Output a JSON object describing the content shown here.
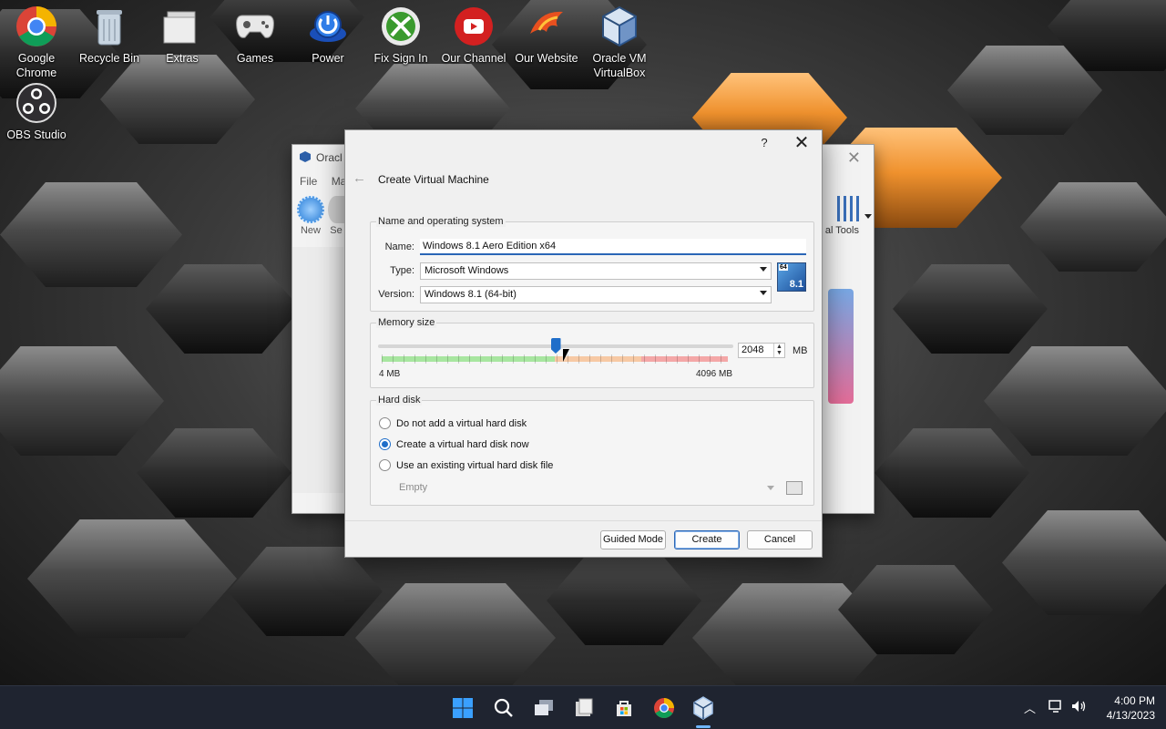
{
  "desktop": {
    "icons": [
      {
        "label": "Google Chrome",
        "icon": "chrome-icon"
      },
      {
        "label": "Recycle Bin",
        "icon": "recycle-bin-icon"
      },
      {
        "label": "Extras",
        "icon": "folder-icon"
      },
      {
        "label": "Games",
        "icon": "gamepad-icon"
      },
      {
        "label": "Power",
        "icon": "power-icon"
      },
      {
        "label": "Fix Sign In",
        "icon": "xbox-icon"
      },
      {
        "label": "Our Channel",
        "icon": "youtube-icon"
      },
      {
        "label": "Our Website",
        "icon": "phoenix-icon"
      },
      {
        "label": "Oracle VM VirtualBox",
        "icon": "virtualbox-icon"
      },
      {
        "label": "OBS Studio",
        "icon": "obs-icon"
      }
    ]
  },
  "bg_window": {
    "title": "Oracl",
    "menu_file": "File",
    "menu_machine": "Ma",
    "toolbar_new": "New",
    "toolbar_settings": "Se",
    "toolbar_tools": "al Tools"
  },
  "dialog": {
    "help": "?",
    "close": "✕",
    "back": "←",
    "title": "Create Virtual Machine",
    "name_os_group": "Name and operating system",
    "name_label": "Name:",
    "name_value": "Windows 8.1 Aero Edition x64",
    "type_label": "Type:",
    "type_value": "Microsoft Windows",
    "version_label": "Version:",
    "version_value": "Windows 8.1 (64-bit)",
    "os_badge_bits": "64",
    "os_badge_version": "8.1",
    "memory_group": "Memory size",
    "memory_min": "4 MB",
    "memory_max": "4096 MB",
    "memory_value": "2048",
    "memory_unit": "MB",
    "memory_fraction": 0.5,
    "hard_disk_group": "Hard disk",
    "disk_options": [
      {
        "label": "Do not add a virtual hard disk",
        "checked": false
      },
      {
        "label": "Create a virtual hard disk now",
        "checked": true
      },
      {
        "label": "Use an existing virtual hard disk file",
        "checked": false
      }
    ],
    "disk_file_value": "Empty",
    "buttons": {
      "guided": "Guided Mode",
      "create": "Create",
      "cancel": "Cancel"
    }
  },
  "taskbar": {
    "time": "4:00 PM",
    "date": "4/13/2023",
    "apps": [
      "windows-start-icon",
      "search-icon",
      "task-view-icon",
      "file-explorer-icon",
      "store-icon",
      "chrome-icon",
      "virtualbox-icon"
    ],
    "active_app": "virtualbox-icon"
  },
  "colors": {
    "accent": "#1f6ec9",
    "taskbar": "#1f2430"
  }
}
